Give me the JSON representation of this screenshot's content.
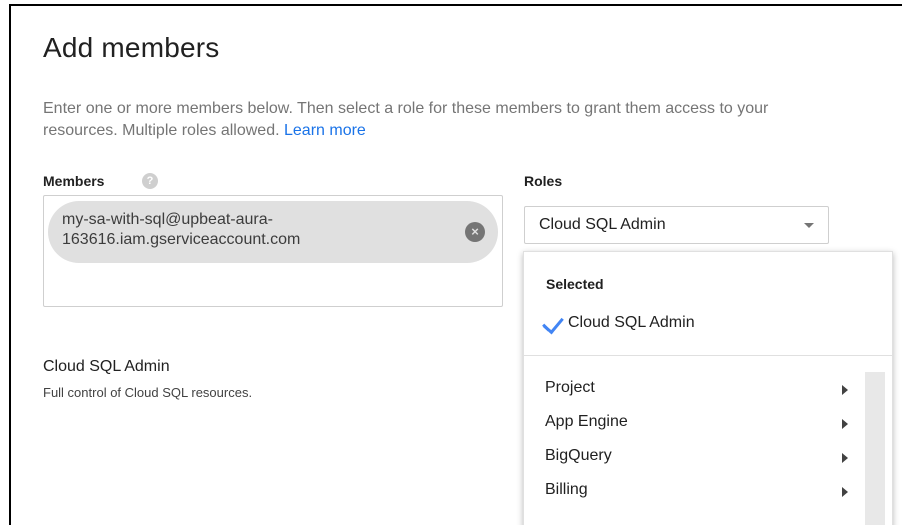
{
  "dialog": {
    "title": "Add members",
    "description": "Enter one or more members below. Then select a role for these members to grant them access to your resources. Multiple roles allowed.",
    "learn_more": "Learn more"
  },
  "members": {
    "label": "Members",
    "help_glyph": "?",
    "chip_text": "my-sa-with-sql@upbeat-aura-163616.iam.gserviceaccount.com",
    "remove_glyph": "×"
  },
  "roles": {
    "label": "Roles",
    "selected_value": "Cloud SQL Admin",
    "dropdown": {
      "selected_header": "Selected",
      "selected_item": "Cloud SQL Admin",
      "items": [
        {
          "label": "Project"
        },
        {
          "label": "App Engine"
        },
        {
          "label": "BigQuery"
        },
        {
          "label": "Billing"
        }
      ]
    }
  },
  "role_info": {
    "title": "Cloud SQL Admin",
    "description": "Full control of Cloud SQL resources."
  },
  "colors": {
    "link": "#1a73e8",
    "check": "#4285f4",
    "chip_bg": "#e0e0e0"
  },
  "icons": [
    "help-icon",
    "chip-remove-icon",
    "dropdown-arrow-icon",
    "check-icon",
    "submenu-arrow-icon"
  ]
}
